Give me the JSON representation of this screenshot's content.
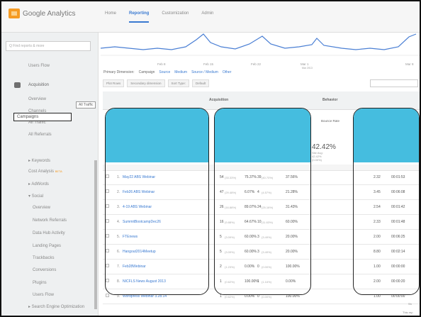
{
  "app": {
    "logo_text": "Google Analytics",
    "brand_color": "#f59b23",
    "accent_color": "#3a7ad1",
    "overlay_color": "#45bddf"
  },
  "nav": [
    "Home",
    "Reporting",
    "Customization",
    "Admin"
  ],
  "nav_active": "Reporting",
  "sidebar": {
    "search_placeholder": "Q Find reports & more",
    "users_flow": "Users Flow",
    "acquisition": "Acquisition",
    "items": [
      "Overview",
      "Channels",
      "All Traffic",
      "All Referrals",
      "Campaigns",
      "▸ Keywords",
      "Cost Analysis",
      "▸ AdWords",
      "▾ Social",
      "Overview",
      "Network Referrals",
      "Data Hub Activity",
      "Landing Pages",
      "Trackbacks",
      "Conversions",
      "Plugins",
      "Users Flow",
      "▸ Search Engine Optimization"
    ],
    "cost_badge": "BETA",
    "tooltip": "All Traffic",
    "selected": "Campaigns"
  },
  "chart": {
    "x_labels": [
      "Feb 8",
      "Feb 15",
      "Feb 22",
      "Mar 1",
      "Mar 8"
    ],
    "sub_label": "Mar 2013"
  },
  "report_tabs": {
    "label": "Primary Dimension:",
    "active": "Campaign",
    "links": [
      "Source",
      "Medium",
      "Source / Medium",
      "Other"
    ]
  },
  "filters": {
    "plot_rows": "Plot Rows",
    "secondary": "Secondary dimension",
    "sort": "Sort Type:",
    "default": "Default"
  },
  "table": {
    "group_acquisition": "Acquisition",
    "group_behavior": "Behavior",
    "bounce_rate_label": "Bounce Rate",
    "summary_bounce": "42.42%",
    "summary_bounce_sub1": "Site Avg:",
    "summary_bounce_sub2": "42.42%",
    "summary_bounce_sub3": "(0.00%)",
    "rows": [
      {
        "n": "1.",
        "name": "May22 ABS Webinar",
        "sessions": "54",
        "sp": "(33.33%)",
        "newp": "75.37%",
        "newu": "39",
        "nup": "(40.70%)",
        "bounce": "37.56%",
        "pages": "2.32",
        "dur": "00:01:53"
      },
      {
        "n": "2.",
        "name": "Feb26 ABS Webinar",
        "sessions": "47",
        "sp": "(29.48%)",
        "newp": "6.07%",
        "newu": "4",
        "nup": "(4.57%)",
        "bounce": "21.28%",
        "pages": "3.45",
        "dur": "00:06:08"
      },
      {
        "n": "3.",
        "name": "4-19 ABS Webinar",
        "sessions": "26",
        "sp": "(16.88%)",
        "newp": "89.07%",
        "newu": "24",
        "nup": "(25.16%)",
        "bounce": "31.43%",
        "pages": "2.54",
        "dur": "00:01:42"
      },
      {
        "n": "4.",
        "name": "SummitBootcampDec26",
        "sessions": "16",
        "sp": "(9.88%)",
        "newp": "64.67%",
        "newu": "10",
        "nup": "(11.63%)",
        "bounce": "60.00%",
        "pages": "2.33",
        "dur": "00:01:48"
      },
      {
        "n": "5.",
        "name": "FTEnews",
        "sessions": "5",
        "sp": "(3.09%)",
        "newp": "60.00%",
        "newu": "3",
        "nup": "(3.49%)",
        "bounce": "20.00%",
        "pages": "2.00",
        "dur": "00:06:25"
      },
      {
        "n": "6.",
        "name": "Hangout2014Meetup",
        "sessions": "5",
        "sp": "(3.09%)",
        "newp": "60.00%",
        "newu": "3",
        "nup": "(3.49%)",
        "bounce": "20.00%",
        "pages": "8.80",
        "dur": "00:02:14"
      },
      {
        "n": "7.",
        "name": "Feb28Webinar",
        "sessions": "2",
        "sp": "(1.23%)",
        "newp": "0.00%",
        "newu": "0",
        "nup": "(0.00%)",
        "bounce": "100.00%",
        "pages": "1.00",
        "dur": "00:00:00"
      },
      {
        "n": "8.",
        "name": "NICFLS News August 2013",
        "sessions": "1",
        "sp": "(0.62%)",
        "newp": "100.00%",
        "newu": "1",
        "nup": "(1.16%)",
        "bounce": "0.00%",
        "pages": "2.00",
        "dur": "00:00:20"
      },
      {
        "n": "9.",
        "name": "Wordpress Webinar 3.28.14",
        "sessions": "1",
        "sp": "(0.62%)",
        "newp": "0.00%",
        "newu": "0",
        "nup": "(0.00%)",
        "bounce": "100.00%",
        "pages": "1.00",
        "dur": "00:00:00"
      }
    ]
  },
  "footer": {
    "show": "Sh",
    "time": "This rep"
  }
}
